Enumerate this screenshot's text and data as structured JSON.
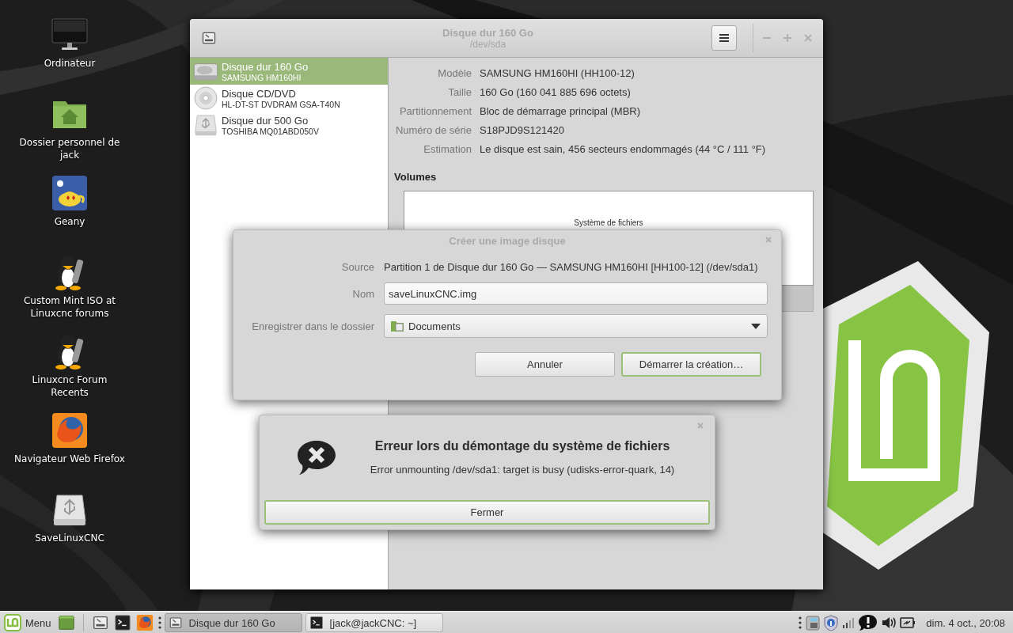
{
  "desktop_icons": [
    {
      "label": "Ordinateur",
      "kind": "monitor"
    },
    {
      "label": "Dossier personnel de jack",
      "kind": "home"
    },
    {
      "label": "Geany",
      "kind": "geany"
    },
    {
      "label": "Custom Mint ISO at Linuxcnc forums",
      "kind": "penguin"
    },
    {
      "label": "Linuxcnc Forum Recents",
      "kind": "penguin"
    },
    {
      "label": "Navigateur Web Firefox",
      "kind": "firefox"
    },
    {
      "label": "SaveLinuxCNC",
      "kind": "usb"
    }
  ],
  "disks_window": {
    "title": "Disque dur 160 Go",
    "subtitle": "/dev/sda",
    "disks": [
      {
        "name": "Disque dur 160 Go",
        "model": "SAMSUNG HM160HI",
        "kind": "hdd",
        "selected": true
      },
      {
        "name": "Disque CD/DVD",
        "model": "HL-DT-ST DVDRAM GSA-T40N",
        "kind": "optical",
        "selected": false
      },
      {
        "name": "Disque dur 500 Go",
        "model": "TOSHIBA MQ01ABD050V",
        "kind": "usb",
        "selected": false
      }
    ],
    "details": [
      {
        "label": "Modèle",
        "value": "SAMSUNG HM160HI (HH100-12)"
      },
      {
        "label": "Taille",
        "value": "160 Go (160 041 885 696 octets)"
      },
      {
        "label": "Partitionnement",
        "value": "Bloc de démarrage principal (MBR)"
      },
      {
        "label": "Numéro de série",
        "value": "S18PJD9S121420"
      },
      {
        "label": "Estimation",
        "value": "Le disque est sain, 456 secteurs endommagés (44 °C / 111 °F)"
      }
    ],
    "volumes_heading": "Volumes",
    "volume_label": "Système de fichiers"
  },
  "create_image_dialog": {
    "title": "Créer une image disque",
    "source_label": "Source",
    "source": "Partition 1 de Disque dur 160 Go — SAMSUNG HM160HI [HH100-12] (/dev/sda1)",
    "name_label": "Nom",
    "name_value": "saveLinuxCNC.img",
    "folder_label": "Enregistrer dans le dossier",
    "folder": "Documents",
    "buttons": [
      {
        "label": "Annuler",
        "default": false
      },
      {
        "label": "Démarrer la création…",
        "default": true
      }
    ]
  },
  "error_dialog": {
    "title": "Erreur lors du démontage du système de fichiers",
    "message": "Error unmounting /dev/sda1: target is busy (udisks-error-quark, 14)",
    "button": "Fermer"
  },
  "taskbar": {
    "menu_label": "Menu",
    "launchers": [
      {
        "kind": "desktop"
      },
      {
        "kind": "disks"
      },
      {
        "kind": "terminal"
      },
      {
        "kind": "firefox"
      }
    ],
    "tasks": [
      {
        "label": "Disque dur 160 Go",
        "kind": "disks",
        "selected": true
      },
      {
        "label": "[jack@jackCNC: ~]",
        "kind": "terminal",
        "selected": false
      }
    ],
    "clock": "dim. 4 oct., 20:08"
  }
}
